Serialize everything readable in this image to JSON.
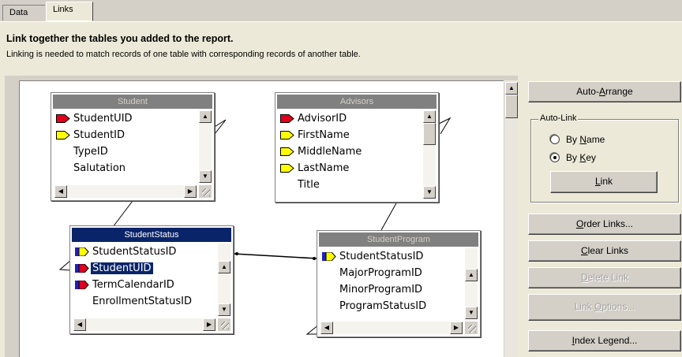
{
  "tabs": [
    {
      "label": "Data",
      "active": false
    },
    {
      "label": "Links",
      "active": true
    }
  ],
  "heading": "Link together the tables you added to the report.",
  "subheading": "Linking is needed to match records of one table with corresponding records of another table.",
  "tables": {
    "student": {
      "title": "Student",
      "fields": [
        {
          "name": "StudentUID",
          "key": "red"
        },
        {
          "name": "StudentID",
          "key": "yellow"
        },
        {
          "name": "TypeID",
          "key": "none"
        },
        {
          "name": "Salutation",
          "key": "none"
        }
      ]
    },
    "advisors": {
      "title": "Advisors",
      "fields": [
        {
          "name": "AdvisorID",
          "key": "red"
        },
        {
          "name": "FirstName",
          "key": "yellow"
        },
        {
          "name": "MiddleName",
          "key": "yellow"
        },
        {
          "name": "LastName",
          "key": "yellow"
        },
        {
          "name": "Title",
          "key": "none"
        }
      ]
    },
    "student_status": {
      "title": "StudentStatus",
      "fields": [
        {
          "name": "StudentStatusID",
          "key": "yellow-blue"
        },
        {
          "name": "StudentUID",
          "key": "red-blue",
          "selected": true
        },
        {
          "name": "TermCalendarID",
          "key": "red-blue"
        },
        {
          "name": "EnrollmentStatusID",
          "key": "none"
        }
      ]
    },
    "student_program": {
      "title": "StudentProgram",
      "fields": [
        {
          "name": "StudentStatusID",
          "key": "yellow-blue"
        },
        {
          "name": "MajorProgramID",
          "key": "none"
        },
        {
          "name": "MinorProgramID",
          "key": "none"
        },
        {
          "name": "ProgramStatusID",
          "key": "none"
        }
      ]
    }
  },
  "buttons": {
    "auto_arrange": {
      "pre": "Auto-",
      "u": "A",
      "post": "rrange"
    },
    "auto_link_group": "Auto-Link",
    "by_name": {
      "pre": "By ",
      "u": "N",
      "post": "ame",
      "checked": false
    },
    "by_key": {
      "pre": "By ",
      "u": "K",
      "post": "ey",
      "checked": true
    },
    "link": {
      "pre": "",
      "u": "L",
      "post": "ink"
    },
    "order_links": {
      "pre": "",
      "u": "O",
      "post": "rder Links..."
    },
    "clear_links": {
      "pre": "",
      "u": "C",
      "post": "lear Links"
    },
    "delete_link": {
      "pre": "",
      "u": "D",
      "post": "elete Link",
      "disabled": true
    },
    "link_options": {
      "pre": "Link ",
      "u": "O",
      "post": "ptions...",
      "disabled": true
    },
    "index_legend": {
      "pre": "",
      "u": "I",
      "post": "ndex Legend..."
    }
  },
  "colors": {
    "key_red": "#e0001b",
    "key_yellow": "#ffff00",
    "key_blue": "#2020c0",
    "active_title": "#0a246a",
    "inactive_title": "#808080"
  }
}
